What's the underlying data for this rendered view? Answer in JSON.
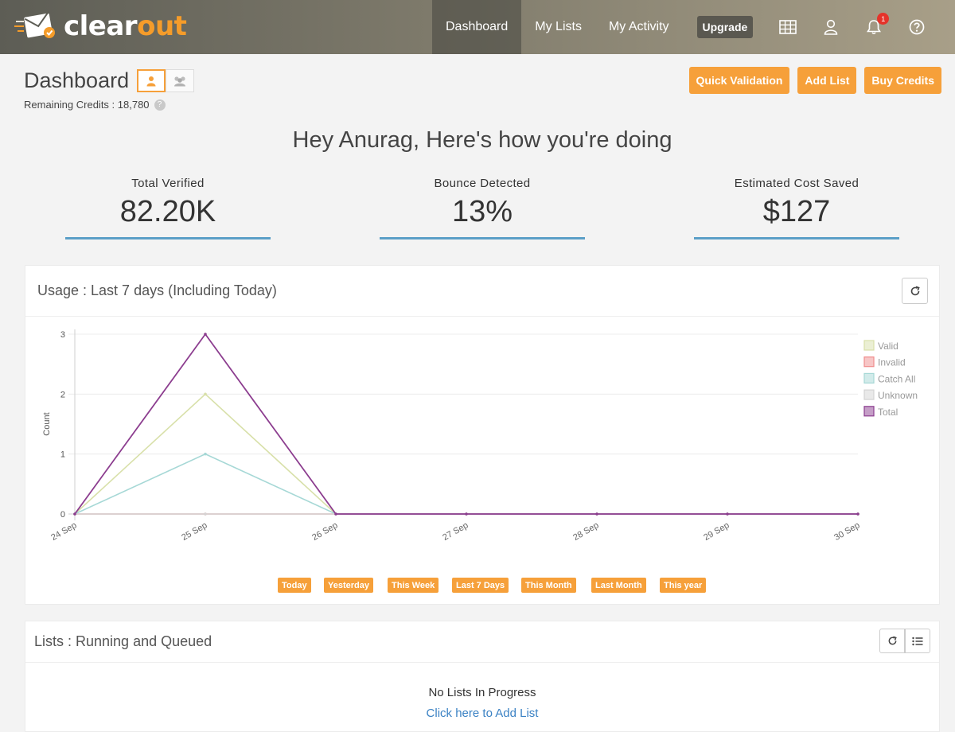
{
  "navbar": {
    "logo_part1": "clear",
    "logo_part2": "out",
    "items": [
      "Dashboard",
      "My Lists",
      "My Activity"
    ],
    "upgrade": "Upgrade",
    "notification_count": "1",
    "icons": [
      "grid-icon",
      "user-icon",
      "bell-icon",
      "help-icon"
    ]
  },
  "header": {
    "title": "Dashboard",
    "credits": "Remaining Credits : 18,780",
    "buttons": [
      "Quick Validation",
      "Add List",
      "Buy Credits"
    ]
  },
  "greeting": "Hey Anurag, Here's how you're doing",
  "stats": [
    {
      "label": "Total Verified",
      "value": "82.20K"
    },
    {
      "label": "Bounce Detected",
      "value": "13%"
    },
    {
      "label": "Estimated Cost Saved",
      "value": "$127"
    }
  ],
  "usage_panel": {
    "title": "Usage : Last 7 days (Including Today)",
    "ranges": [
      "Today",
      "Yesterday",
      "This Week",
      "Last 7 Days",
      "This Month",
      "Last Month",
      "This year"
    ]
  },
  "chart_data": {
    "type": "line",
    "x": [
      "24 Sep",
      "25 Sep",
      "26 Sep",
      "27 Sep",
      "28 Sep",
      "29 Sep",
      "30 Sep"
    ],
    "ylabel": "Count",
    "xlabel": "",
    "ylim": [
      0,
      3
    ],
    "yticks": [
      0,
      1,
      2,
      3
    ],
    "legend_position": "right",
    "series": [
      {
        "name": "Valid",
        "values": [
          0,
          2,
          0,
          0,
          0,
          0,
          0
        ],
        "color": "#d8e0a9"
      },
      {
        "name": "Invalid",
        "values": [
          0,
          0,
          0,
          0,
          0,
          0,
          0
        ],
        "color": "#f08d8d"
      },
      {
        "name": "Catch All",
        "values": [
          0,
          1,
          0,
          0,
          0,
          0,
          0
        ],
        "color": "#a6d8d6"
      },
      {
        "name": "Unknown",
        "values": [
          0,
          0,
          0,
          0,
          0,
          0,
          0
        ],
        "color": "#d4d4d4"
      },
      {
        "name": "Total",
        "values": [
          0,
          3,
          0,
          0,
          0,
          0,
          0
        ],
        "color": "#8c3d8f"
      }
    ]
  },
  "lists_panel": {
    "title": "Lists : Running and Queued",
    "empty_text": "No Lists In Progress",
    "add_link": "Click here to Add List"
  },
  "colors": {
    "accent": "#f6a03a",
    "stat_line": "#5b9fc7"
  }
}
